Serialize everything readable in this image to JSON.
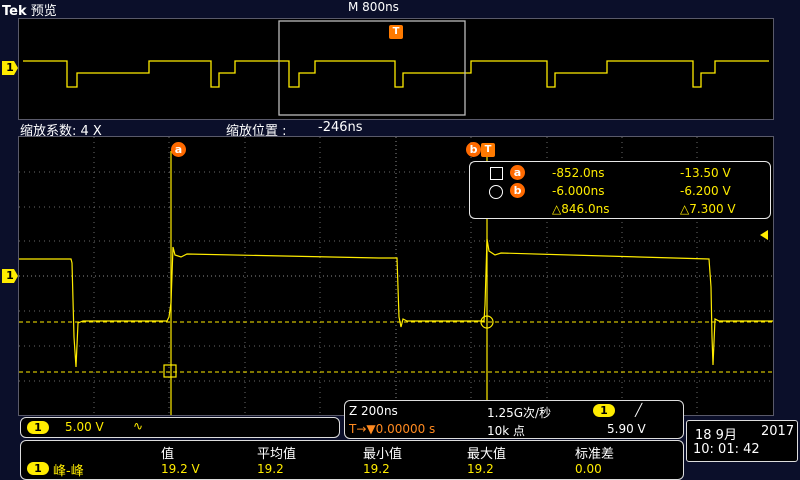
{
  "header": {
    "brand": "Tek",
    "mode": "预览",
    "timebase": "M 800ns"
  },
  "overview": {
    "channel": "1",
    "trigger_marker": "T"
  },
  "zoom": {
    "factor_label": "缩放系数: 4 X",
    "position_label": "缩放位置 :",
    "position_value": "-246ns"
  },
  "main": {
    "channel": "1",
    "trigger_marker": "T"
  },
  "cursors": {
    "a_label": "a",
    "b_label": "b",
    "a": {
      "time": "-852.0ns",
      "voltage": "-13.50 V"
    },
    "b": {
      "time": "-6.000ns",
      "voltage": "-6.200 V"
    },
    "delta": {
      "time": "△846.0ns",
      "voltage": "△7.300 V"
    }
  },
  "channel_settings": {
    "channel": "1",
    "scale": "5.00 V",
    "coupling_symbol": "∿"
  },
  "acquisition": {
    "zoom_timebase": "Z 200ns",
    "sample_rate": "1.25G次/秒",
    "record_length": "10k 点",
    "trigger_position": "T→▼0.00000 s",
    "trigger_channel": "1",
    "trigger_slope": "╱",
    "trigger_level": "5.90 V"
  },
  "measurements": {
    "headers": [
      "值",
      "平均值",
      "最小值",
      "最大值",
      "标准差"
    ],
    "row": {
      "channel": "1",
      "name": "峰-峰",
      "values": [
        "19.2 V",
        "19.2",
        "19.2",
        "19.2",
        "0.00"
      ]
    }
  },
  "datetime": {
    "date": "18 9月",
    "year": "2017",
    "time": "10: 01: 42"
  },
  "colors": {
    "trace": "#ffec00",
    "cursor": "#ff6a00",
    "background": "#000000",
    "grid": "#6a6a6a"
  }
}
